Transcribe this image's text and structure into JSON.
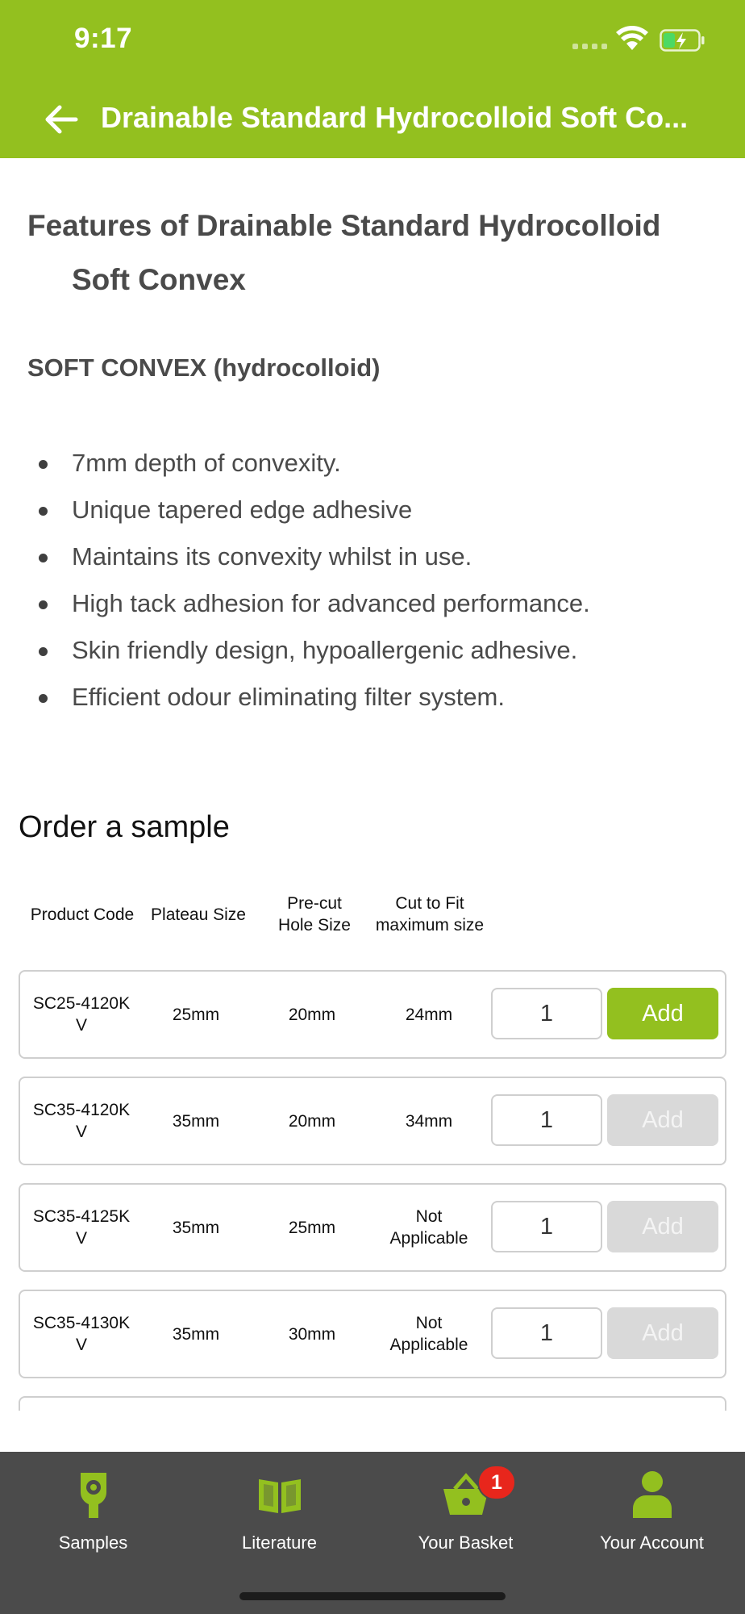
{
  "status_bar": {
    "time": "9:17"
  },
  "header": {
    "title": "Drainable Standard Hydrocolloid Soft Co..."
  },
  "features": {
    "title_line1": "Features of Drainable Standard Hydrocolloid",
    "title_line2": "Soft Convex",
    "subtitle": "SOFT CONVEX (hydrocolloid)",
    "bullets": [
      "7mm depth of convexity.",
      "Unique tapered edge adhesive",
      "Maintains its convexity whilst in use.",
      "High tack adhesion for advanced performance.",
      "Skin friendly design, hypoallergenic adhesive.",
      "Efficient odour eliminating filter system."
    ]
  },
  "order": {
    "title": "Order a sample",
    "columns": [
      "Product Code",
      "Plateau Size",
      "Pre-cut\nHole Size",
      "Cut to Fit\nmaximum size"
    ],
    "rows": [
      {
        "code": "SC25-4120K\nV",
        "plateau": "25mm",
        "hole": "20mm",
        "cut": "24mm",
        "qty": "1",
        "add_label": "Add",
        "add_state": "active"
      },
      {
        "code": "SC35-4120K\nV",
        "plateau": "35mm",
        "hole": "20mm",
        "cut": "34mm",
        "qty": "1",
        "add_label": "Add",
        "add_state": "disabled"
      },
      {
        "code": "SC35-4125K\nV",
        "plateau": "35mm",
        "hole": "25mm",
        "cut": "Not\nApplicable",
        "qty": "1",
        "add_label": "Add",
        "add_state": "disabled"
      },
      {
        "code": "SC35-4130K\nV",
        "plateau": "35mm",
        "hole": "30mm",
        "cut": "Not\nApplicable",
        "qty": "1",
        "add_label": "Add",
        "add_state": "disabled"
      }
    ]
  },
  "tabs": [
    {
      "label": "Samples",
      "icon": "samples-icon"
    },
    {
      "label": "Literature",
      "icon": "book-icon"
    },
    {
      "label": "Your Basket",
      "icon": "basket-icon",
      "badge": "1"
    },
    {
      "label": "Your Account",
      "icon": "account-icon"
    }
  ],
  "colors": {
    "brand_green": "#93c01f",
    "tabbar": "#4b4b4b",
    "badge_red": "#e8261c",
    "disabled": "#d9d9d9"
  }
}
